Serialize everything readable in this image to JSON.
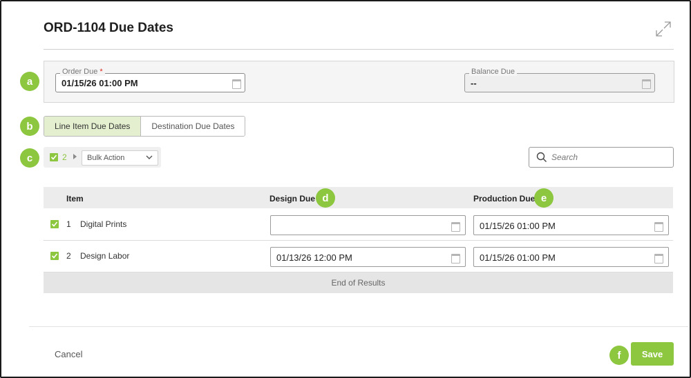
{
  "modal": {
    "title": "ORD-1104 Due Dates"
  },
  "badges": {
    "a": "a",
    "b": "b",
    "c": "c",
    "d": "d",
    "e": "e",
    "f": "f"
  },
  "order_fields": {
    "order_due_label": "Order Due",
    "order_due_required": "*",
    "order_due_value": "01/15/26 01:00 PM",
    "balance_due_label": "Balance Due",
    "balance_due_value": "--"
  },
  "tabs": [
    {
      "label": "Line Item Due Dates",
      "active": true
    },
    {
      "label": "Destination Due Dates",
      "active": false
    }
  ],
  "bulk": {
    "selected_count": "2",
    "action_label": "Bulk Action"
  },
  "search": {
    "placeholder": "Search"
  },
  "table": {
    "headers": {
      "item": "Item",
      "design_due": "Design Due",
      "production_due": "Production Due"
    },
    "rows": [
      {
        "num": "1",
        "name": "Digital Prints",
        "design_due": "",
        "production_due": "01/15/26 01:00 PM",
        "checked": true
      },
      {
        "num": "2",
        "name": "Design Labor",
        "design_due": "01/13/26 12:00 PM",
        "production_due": "01/15/26 01:00 PM",
        "checked": true
      }
    ],
    "end_text": "End of Results"
  },
  "footer": {
    "cancel_label": "Cancel",
    "save_label": "Save"
  },
  "colors": {
    "accent": "#8dc63f",
    "tab_active_bg": "#e3efcf",
    "required": "#d9261c"
  },
  "icons": [
    "expand-icon",
    "calendar-icon",
    "search-icon",
    "checkbox-checked-icon",
    "chevron-down-icon",
    "caret-right-icon"
  ]
}
